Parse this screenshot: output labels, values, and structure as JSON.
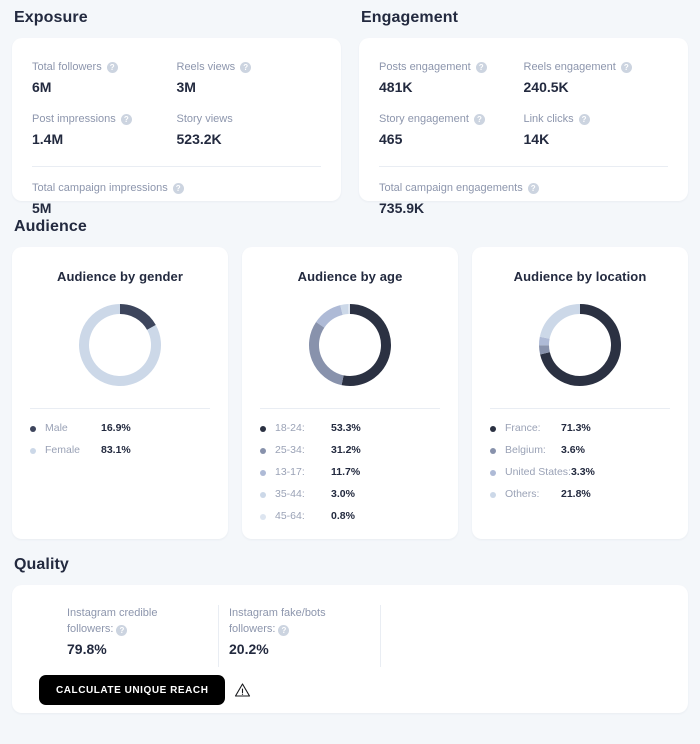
{
  "exposure": {
    "title": "Exposure",
    "metrics": [
      {
        "label": "Total followers",
        "value": "6M",
        "info": true
      },
      {
        "label": "Reels views",
        "value": "3M",
        "info": true
      },
      {
        "label": "Post impressions",
        "value": "1.4M",
        "info": true
      },
      {
        "label": "Story views",
        "value": "523.2K",
        "info": false
      }
    ],
    "total": {
      "label": "Total campaign impressions",
      "value": "5M",
      "info": true
    }
  },
  "engagement": {
    "title": "Engagement",
    "metrics": [
      {
        "label": "Posts engagement",
        "value": "481K",
        "info": true
      },
      {
        "label": "Reels engagement",
        "value": "240.5K",
        "info": true
      },
      {
        "label": "Story engagement",
        "value": "465",
        "info": true
      },
      {
        "label": "Link clicks",
        "value": "14K",
        "info": true
      }
    ],
    "total": {
      "label": "Total campaign engagements",
      "value": "735.9K",
      "info": true
    }
  },
  "audience": {
    "title": "Audience",
    "charts": [
      {
        "title": "Audience by gender",
        "legend": [
          {
            "label": "Male",
            "value": "16.9%",
            "color": "#3d455c"
          },
          {
            "label": "Female",
            "value": "83.1%",
            "color": "#ccd8e8"
          }
        ]
      },
      {
        "title": "Audience by age",
        "legend": [
          {
            "label": "18-24:",
            "value": "53.3%",
            "color": "#2b3142"
          },
          {
            "label": "25-34:",
            "value": "31.2%",
            "color": "#8892ac"
          },
          {
            "label": "13-17:",
            "value": "11.7%",
            "color": "#aebad6"
          },
          {
            "label": "35-44:",
            "value": "3.0%",
            "color": "#ccd8e8"
          },
          {
            "label": "45-64:",
            "value": "0.8%",
            "color": "#dde5f0"
          }
        ]
      },
      {
        "title": "Audience by location",
        "legend": [
          {
            "label": "France:",
            "value": "71.3%",
            "color": "#2b3142"
          },
          {
            "label": "Belgium:",
            "value": "3.6%",
            "color": "#8892ac"
          },
          {
            "label": "United States:",
            "value": "3.3%",
            "color": "#aebad6"
          },
          {
            "label": "Others:",
            "value": "21.8%",
            "color": "#ccd8e8"
          }
        ]
      }
    ]
  },
  "quality": {
    "title": "Quality",
    "stats": [
      {
        "label": "Instagram credible followers:",
        "value": "79.8%",
        "info": true
      },
      {
        "label": "Instagram fake/bots followers:",
        "value": "20.2%",
        "info": true
      }
    ],
    "button_label": "CALCULATE UNIQUE REACH",
    "warning_icon": "warning-triangle-icon"
  },
  "icons": {
    "info": "?"
  },
  "chart_data": [
    {
      "type": "pie",
      "title": "Audience by gender",
      "categories": [
        "Male",
        "Female"
      ],
      "values": [
        16.9,
        83.1
      ],
      "colors": [
        "#3d455c",
        "#ccd8e8"
      ],
      "unit": "%",
      "donut": true,
      "legend_position": "bottom"
    },
    {
      "type": "pie",
      "title": "Audience by age",
      "categories": [
        "18-24",
        "25-34",
        "13-17",
        "35-44",
        "45-64"
      ],
      "values": [
        53.3,
        31.2,
        11.7,
        3.0,
        0.8
      ],
      "colors": [
        "#2b3142",
        "#8892ac",
        "#aebad6",
        "#ccd8e8",
        "#dde5f0"
      ],
      "unit": "%",
      "donut": true,
      "legend_position": "bottom"
    },
    {
      "type": "pie",
      "title": "Audience by location",
      "categories": [
        "France",
        "Belgium",
        "United States",
        "Others"
      ],
      "values": [
        71.3,
        3.6,
        3.3,
        21.8
      ],
      "colors": [
        "#2b3142",
        "#8892ac",
        "#aebad6",
        "#ccd8e8"
      ],
      "unit": "%",
      "donut": true,
      "legend_position": "bottom"
    }
  ]
}
